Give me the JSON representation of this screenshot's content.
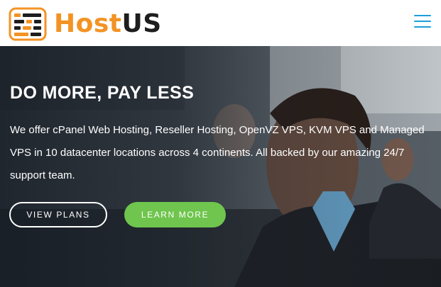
{
  "header": {
    "logo_part1": "Host",
    "logo_part2": "US",
    "menu_icon": "hamburger-menu-icon"
  },
  "hero": {
    "headline": "DO MORE, PAY LESS",
    "description": "We offer cPanel Web Hosting, Reseller Hosting, OpenVZ VPS, KVM VPS and Managed VPS in 10 datacenter locations across 4 continents. All backed by our amazing 24/7 support team.",
    "buttons": {
      "view_plans": "VIEW PLANS",
      "learn_more": "LEARN MORE"
    }
  },
  "colors": {
    "brand_orange": "#f39324",
    "brand_dark": "#1e1e1e",
    "menu_blue": "#1aa0d8",
    "green_button": "#6fc54d"
  }
}
